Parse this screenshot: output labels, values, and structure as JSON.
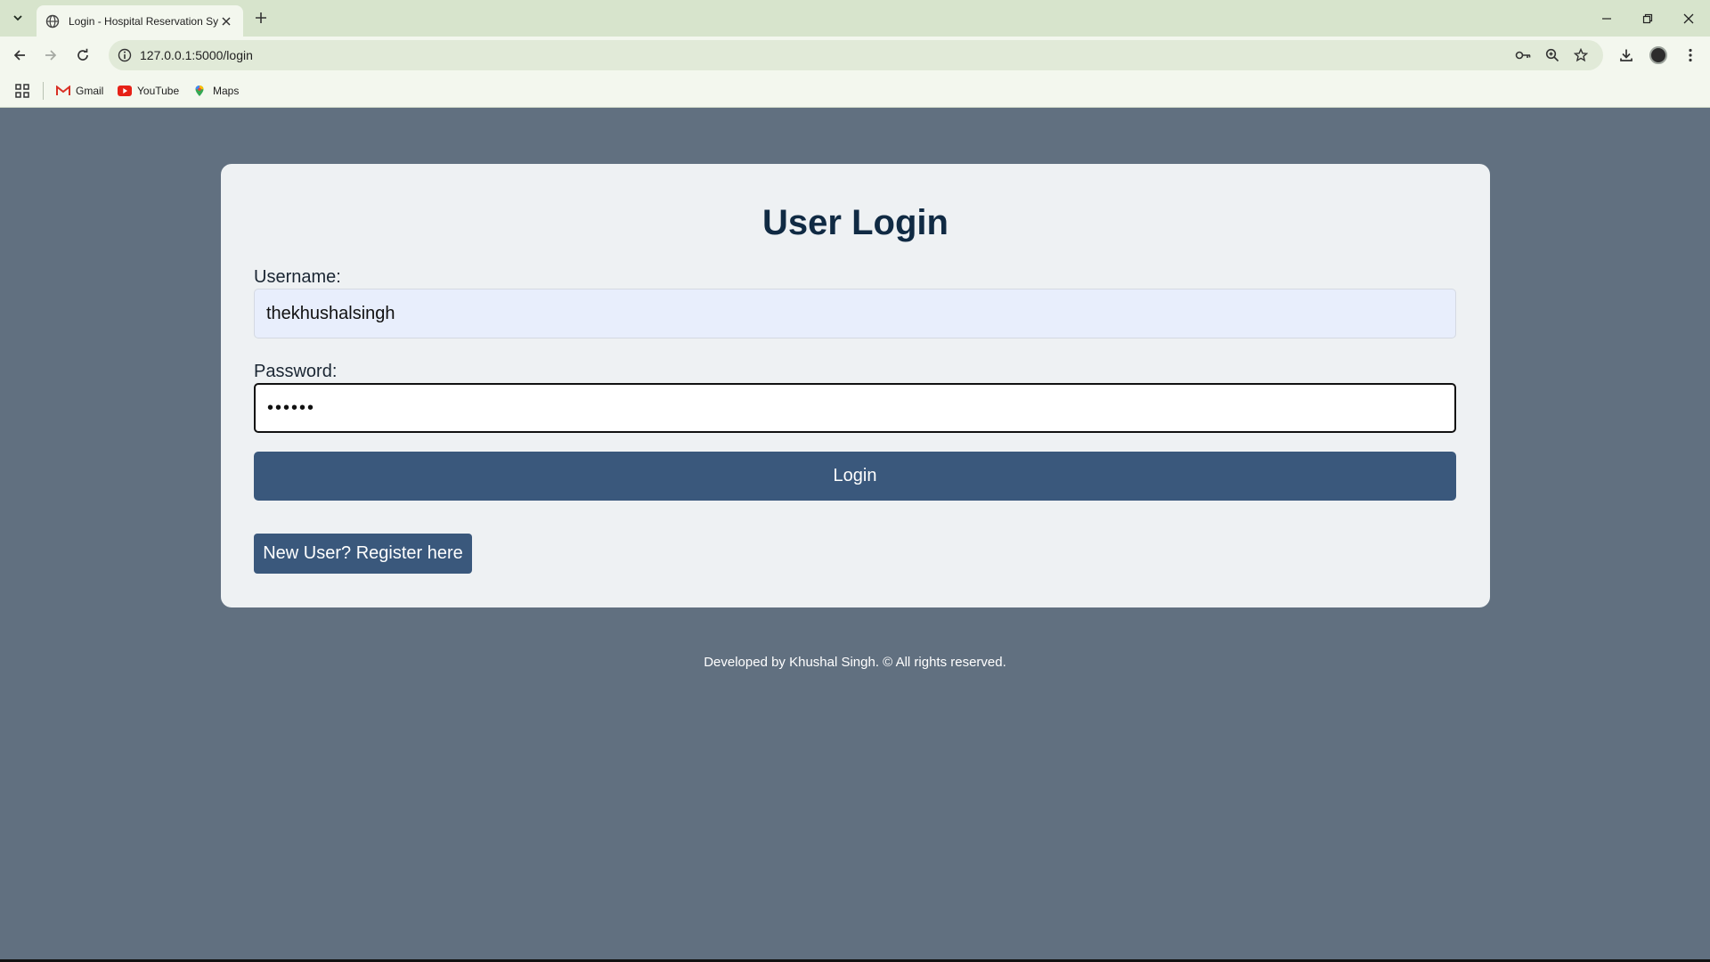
{
  "browser": {
    "tab": {
      "title": "Login - Hospital Reservation Sy",
      "close_icon": "close-icon"
    },
    "url": "127.0.0.1:5000/login",
    "bookmarks": [
      {
        "label": "Gmail",
        "icon": "gmail-icon"
      },
      {
        "label": "YouTube",
        "icon": "youtube-icon"
      },
      {
        "label": "Maps",
        "icon": "maps-icon"
      }
    ]
  },
  "login": {
    "heading": "User Login",
    "username_label": "Username:",
    "username_value": "thekhushalsingh",
    "password_label": "Password:",
    "password_value": "••••••",
    "login_button": "Login",
    "register_button": "New User? Register here"
  },
  "footer": {
    "text": "Developed by Khushal Singh. © All rights reserved."
  },
  "colors": {
    "page_background": "#617080",
    "card_background": "#eef1f3",
    "button": "#3a587c",
    "heading": "#102a43",
    "chrome": "#d7e4cc"
  }
}
